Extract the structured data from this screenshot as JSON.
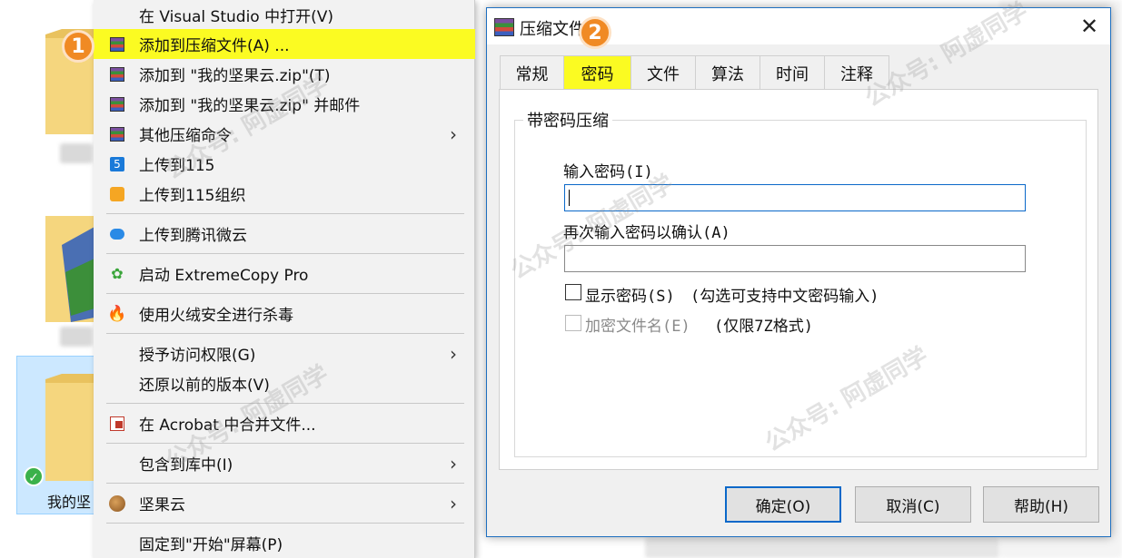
{
  "explorer": {
    "selected_folder_label": "我的坚"
  },
  "context_menu": {
    "items": [
      {
        "label": "在 Visual Studio 中打开(V)",
        "icon": "visual-studio-icon"
      },
      {
        "label": "添加到压缩文件(A) ...",
        "icon": "winrar-icon",
        "highlighted": true
      },
      {
        "label": "添加到 \"我的坚果云.zip\"(T)",
        "icon": "winrar-icon"
      },
      {
        "label": "添加到 \"我的坚果云.zip\" 并邮件",
        "icon": "winrar-icon"
      },
      {
        "label": "其他压缩命令",
        "icon": "winrar-icon",
        "submenu": true
      },
      {
        "label": "上传到115",
        "icon": "115-icon"
      },
      {
        "label": "上传到115组织",
        "icon": "115-org-icon"
      },
      {
        "label": "上传到腾讯微云",
        "icon": "weiyun-icon"
      },
      {
        "label": "启动 ExtremeCopy Pro",
        "icon": "extremecopy-icon"
      },
      {
        "label": "使用火绒安全进行杀毒",
        "icon": "huorong-icon"
      },
      {
        "label": "授予访问权限(G)",
        "icon": "",
        "submenu": true
      },
      {
        "label": "还原以前的版本(V)",
        "icon": ""
      },
      {
        "label": "在 Acrobat 中合并文件...",
        "icon": "acrobat-icon"
      },
      {
        "label": "包含到库中(I)",
        "icon": "",
        "submenu": true
      },
      {
        "label": "坚果云",
        "icon": "jianguoyun-icon",
        "submenu": true
      },
      {
        "label": "固定到\"开始\"屏幕(P)",
        "icon": ""
      }
    ]
  },
  "dialog": {
    "title": "压缩文件",
    "tabs": [
      "常规",
      "密码",
      "文件",
      "算法",
      "时间",
      "注释"
    ],
    "active_tab": "密码",
    "group_title": "带密码压缩",
    "password_label": "输入密码(I)",
    "password_value": "",
    "confirm_label": "再次输入密码以确认(A)",
    "confirm_value": "",
    "show_password_label": "显示密码(S)",
    "show_password_hint": "(勾选可支持中文密码输入)",
    "encrypt_names_label": "加密文件名(E)",
    "encrypt_names_hint": "(仅限7Z格式)",
    "buttons": {
      "ok": "确定(O)",
      "cancel": "取消(C)",
      "help": "帮助(H)"
    }
  },
  "badges": {
    "step1": "1",
    "step2": "2"
  },
  "watermark": "公众号: 阿虚同学",
  "colors": {
    "highlight": "#fbfb22",
    "badge": "#f08a24",
    "accent": "#0a68c9"
  }
}
